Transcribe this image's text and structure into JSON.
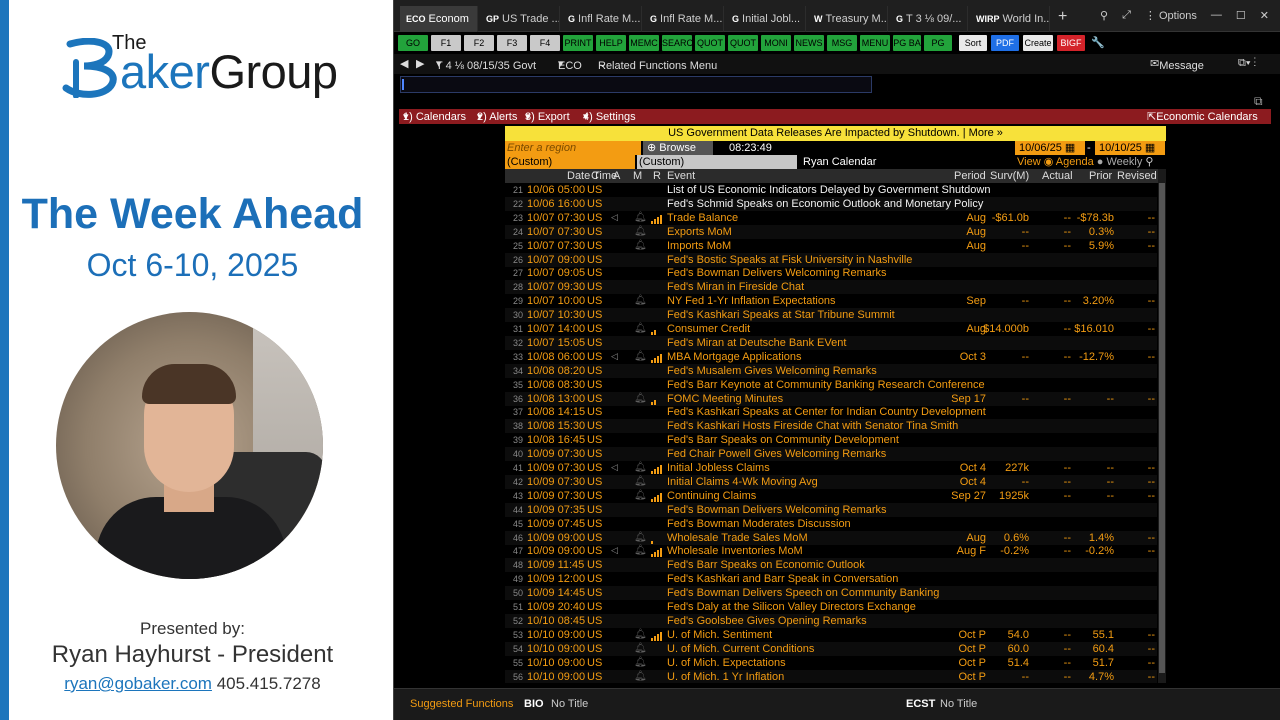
{
  "presentation": {
    "logo_the": "The",
    "logo_aker": "aker",
    "logo_group": "Group",
    "headline": "The Week Ahead",
    "dates": "Oct 6-10, 2025",
    "presented_by": "Presented by:",
    "presenter": "Ryan Hayhurst - President",
    "email": "ryan@gobaker.com",
    "phone": "405.415.7278",
    "accent_color": "#1c75bc"
  },
  "terminal": {
    "tabs": [
      {
        "code": "ECO",
        "label": "Econom"
      },
      {
        "code": "GP",
        "label": "US Trade ..."
      },
      {
        "code": "G",
        "label": "Infl Rate M..."
      },
      {
        "code": "G",
        "label": "Infl Rate M..."
      },
      {
        "code": "G",
        "label": "Initial Jobl..."
      },
      {
        "code": "W",
        "label": "Treasury M..."
      },
      {
        "code": "G",
        "label": "T 3 ⅛ 09/..."
      },
      {
        "code": "WIRP",
        "label": "World In..."
      }
    ],
    "window_controls": {
      "options": "Options"
    },
    "function_keys": [
      {
        "label": "GO",
        "style": "green"
      },
      {
        "label": "F1",
        "style": "grey"
      },
      {
        "label": "F2",
        "style": "grey"
      },
      {
        "label": "F3",
        "style": "grey"
      },
      {
        "label": "F4",
        "style": "grey"
      },
      {
        "label": "PRINT",
        "style": "green"
      },
      {
        "label": "HELP",
        "style": "green"
      },
      {
        "label": "MEMC",
        "style": "green"
      },
      {
        "label": "SEARC",
        "style": "green"
      },
      {
        "label": "QUOT",
        "style": "green"
      },
      {
        "label": "QUOT",
        "style": "green"
      },
      {
        "label": "MONI",
        "style": "green"
      },
      {
        "label": "NEWS",
        "style": "green"
      },
      {
        "label": "MSG",
        "style": "green"
      },
      {
        "label": "MENU",
        "style": "green"
      },
      {
        "label": "PG BA",
        "style": "green"
      },
      {
        "label": "PG FW",
        "style": "green"
      },
      {
        "label": "Sort",
        "style": "white"
      },
      {
        "label": "PDF",
        "style": "blue"
      },
      {
        "label": "Create",
        "style": "white"
      },
      {
        "label": "BIGF",
        "style": "red"
      }
    ],
    "nav": {
      "security": "T 4 ⅛ 08/15/35 Govt",
      "function": "ECO",
      "related": "Related Functions Menu",
      "message": "Message"
    },
    "menu": {
      "calendars": "1) Calendars",
      "alerts": "2) Alerts",
      "export": "3) Export",
      "settings": "4) Settings",
      "economic_calendars": "Economic Calendars"
    },
    "banner": "US Government Data Releases Are Impacted by Shutdown. | More »",
    "region_placeholder": "Enter a region",
    "browse": "Browse",
    "time": "08:23:49",
    "date_from": "10/06/25",
    "date_to": "10/10/25",
    "custom1": "(Custom)",
    "custom2": "(Custom)",
    "calendar_name": "Ryan Calendar",
    "view_label": "View",
    "view_agenda": "Agenda",
    "view_weekly": "Weekly",
    "columns": {
      "datetime": "Date Time",
      "c": "C",
      "a": "A",
      "m": "M",
      "r": "R",
      "event": "Event",
      "period": "Period",
      "surv": "Surv(M)",
      "actual": "Actual",
      "prior": "Prior",
      "revised": "Revised"
    },
    "rows": [
      {
        "n": "21",
        "dt": "10/06 05:00",
        "c": "US",
        "ev": "List of US Economic Indicators Delayed by Government Shutdown",
        "color": "white",
        "per": "",
        "surv": "",
        "act": "",
        "prior": "",
        "rev": "",
        "bell": false,
        "bars": 0,
        "spk": false
      },
      {
        "n": "22",
        "dt": "10/06 16:00",
        "c": "US",
        "ev": "Fed's Schmid Speaks on Economic Outlook and Monetary Policy",
        "color": "white",
        "per": "",
        "surv": "",
        "act": "",
        "prior": "",
        "rev": "",
        "bell": false,
        "bars": 0,
        "spk": false
      },
      {
        "n": "23",
        "dt": "10/07 07:30",
        "c": "US",
        "ev": "Trade Balance",
        "color": "orange",
        "per": "Aug",
        "surv": "-$61.0b",
        "act": "--",
        "prior": "-$78.3b",
        "rev": "--",
        "bell": true,
        "bars": 4,
        "spk": true
      },
      {
        "n": "24",
        "dt": "10/07 07:30",
        "c": "US",
        "ev": "Exports MoM",
        "color": "orange",
        "per": "Aug",
        "surv": "--",
        "act": "--",
        "prior": "0.3%",
        "rev": "--",
        "bell": true,
        "bars": 0,
        "spk": false
      },
      {
        "n": "25",
        "dt": "10/07 07:30",
        "c": "US",
        "ev": "Imports MoM",
        "color": "orange",
        "per": "Aug",
        "surv": "--",
        "act": "--",
        "prior": "5.9%",
        "rev": "--",
        "bell": true,
        "bars": 0,
        "spk": false
      },
      {
        "n": "26",
        "dt": "10/07 09:00",
        "c": "US",
        "ev": "Fed's Bostic Speaks at Fisk University in Nashville",
        "color": "orange",
        "per": "",
        "surv": "",
        "act": "",
        "prior": "",
        "rev": "",
        "bell": false,
        "bars": 0,
        "spk": false
      },
      {
        "n": "27",
        "dt": "10/07 09:05",
        "c": "US",
        "ev": "Fed's Bowman Delivers Welcoming Remarks",
        "color": "orange",
        "per": "",
        "surv": "",
        "act": "",
        "prior": "",
        "rev": "",
        "bell": false,
        "bars": 0,
        "spk": false
      },
      {
        "n": "28",
        "dt": "10/07 09:30",
        "c": "US",
        "ev": "Fed's Miran in Fireside Chat",
        "color": "orange",
        "per": "",
        "surv": "",
        "act": "",
        "prior": "",
        "rev": "",
        "bell": false,
        "bars": 0,
        "spk": false
      },
      {
        "n": "29",
        "dt": "10/07 10:00",
        "c": "US",
        "ev": "NY Fed 1-Yr Inflation Expectations",
        "color": "orange",
        "per": "Sep",
        "surv": "--",
        "act": "--",
        "prior": "3.20%",
        "rev": "--",
        "bell": true,
        "bars": 0,
        "spk": false
      },
      {
        "n": "30",
        "dt": "10/07 10:30",
        "c": "US",
        "ev": "Fed's Kashkari Speaks at Star Tribune Summit",
        "color": "orange",
        "per": "",
        "surv": "",
        "act": "",
        "prior": "",
        "rev": "",
        "bell": false,
        "bars": 0,
        "spk": false
      },
      {
        "n": "31",
        "dt": "10/07 14:00",
        "c": "US",
        "ev": "Consumer Credit",
        "color": "orange",
        "per": "Aug",
        "surv": "$14.000b",
        "act": "--",
        "prior": "$16.010",
        "rev": "--",
        "bell": true,
        "bars": 2,
        "spk": false
      },
      {
        "n": "32",
        "dt": "10/07 15:05",
        "c": "US",
        "ev": "Fed's Miran at Deutsche Bank EVent",
        "color": "orange",
        "per": "",
        "surv": "",
        "act": "",
        "prior": "",
        "rev": "",
        "bell": false,
        "bars": 0,
        "spk": false
      },
      {
        "n": "33",
        "dt": "10/08 06:00",
        "c": "US",
        "ev": "MBA Mortgage Applications",
        "color": "orange",
        "per": "Oct 3",
        "surv": "--",
        "act": "--",
        "prior": "-12.7%",
        "rev": "--",
        "bell": true,
        "bars": 4,
        "spk": true
      },
      {
        "n": "34",
        "dt": "10/08 08:20",
        "c": "US",
        "ev": "Fed's Musalem Gives Welcoming Remarks",
        "color": "orange",
        "per": "",
        "surv": "",
        "act": "",
        "prior": "",
        "rev": "",
        "bell": false,
        "bars": 0,
        "spk": false
      },
      {
        "n": "35",
        "dt": "10/08 08:30",
        "c": "US",
        "ev": "Fed's Barr Keynote at Community Banking Research Conference",
        "color": "orange",
        "per": "",
        "surv": "",
        "act": "",
        "prior": "",
        "rev": "",
        "bell": false,
        "bars": 0,
        "spk": false
      },
      {
        "n": "36",
        "dt": "10/08 13:00",
        "c": "US",
        "ev": "FOMC Meeting Minutes",
        "color": "orange",
        "per": "Sep 17",
        "surv": "--",
        "act": "--",
        "prior": "--",
        "rev": "--",
        "bell": true,
        "bars": 2,
        "spk": false
      },
      {
        "n": "37",
        "dt": "10/08 14:15",
        "c": "US",
        "ev": "Fed's Kashkari Speaks at Center for Indian Country Development",
        "color": "orange",
        "per": "",
        "surv": "",
        "act": "",
        "prior": "",
        "rev": "",
        "bell": false,
        "bars": 0,
        "spk": false
      },
      {
        "n": "38",
        "dt": "10/08 15:30",
        "c": "US",
        "ev": "Fed's Kashkari Hosts Fireside Chat with Senator Tina Smith",
        "color": "orange",
        "per": "",
        "surv": "",
        "act": "",
        "prior": "",
        "rev": "",
        "bell": false,
        "bars": 0,
        "spk": false
      },
      {
        "n": "39",
        "dt": "10/08 16:45",
        "c": "US",
        "ev": "Fed's Barr Speaks on Community Development",
        "color": "orange",
        "per": "",
        "surv": "",
        "act": "",
        "prior": "",
        "rev": "",
        "bell": false,
        "bars": 0,
        "spk": false
      },
      {
        "n": "40",
        "dt": "10/09 07:30",
        "c": "US",
        "ev": "Fed Chair Powell Gives Welcoming Remarks",
        "color": "orange",
        "per": "",
        "surv": "",
        "act": "",
        "prior": "",
        "rev": "",
        "bell": false,
        "bars": 0,
        "spk": false
      },
      {
        "n": "41",
        "dt": "10/09 07:30",
        "c": "US",
        "ev": "Initial Jobless Claims",
        "color": "orange",
        "per": "Oct 4",
        "surv": "227k",
        "act": "--",
        "prior": "--",
        "rev": "--",
        "bell": true,
        "bars": 4,
        "spk": true
      },
      {
        "n": "42",
        "dt": "10/09 07:30",
        "c": "US",
        "ev": "Initial Claims 4-Wk Moving Avg",
        "color": "orange",
        "per": "Oct 4",
        "surv": "--",
        "act": "--",
        "prior": "--",
        "rev": "--",
        "bell": true,
        "bars": 0,
        "spk": false
      },
      {
        "n": "43",
        "dt": "10/09 07:30",
        "c": "US",
        "ev": "Continuing Claims",
        "color": "orange",
        "per": "Sep 27",
        "surv": "1925k",
        "act": "--",
        "prior": "--",
        "rev": "--",
        "bell": true,
        "bars": 4,
        "spk": false
      },
      {
        "n": "44",
        "dt": "10/09 07:35",
        "c": "US",
        "ev": "Fed's Bowman Delivers Welcoming Remarks",
        "color": "orange",
        "per": "",
        "surv": "",
        "act": "",
        "prior": "",
        "rev": "",
        "bell": false,
        "bars": 0,
        "spk": false
      },
      {
        "n": "45",
        "dt": "10/09 07:45",
        "c": "US",
        "ev": "Fed's Bowman Moderates Discussion",
        "color": "orange",
        "per": "",
        "surv": "",
        "act": "",
        "prior": "",
        "rev": "",
        "bell": false,
        "bars": 0,
        "spk": false
      },
      {
        "n": "46",
        "dt": "10/09 09:00",
        "c": "US",
        "ev": "Wholesale Trade Sales MoM",
        "color": "orange",
        "per": "Aug",
        "surv": "0.6%",
        "act": "--",
        "prior": "1.4%",
        "rev": "--",
        "bell": true,
        "bars": 1,
        "spk": false
      },
      {
        "n": "47",
        "dt": "10/09 09:00",
        "c": "US",
        "ev": "Wholesale Inventories MoM",
        "color": "orange",
        "per": "Aug F",
        "surv": "-0.2%",
        "act": "--",
        "prior": "-0.2%",
        "rev": "--",
        "bell": true,
        "bars": 4,
        "spk": true
      },
      {
        "n": "48",
        "dt": "10/09 11:45",
        "c": "US",
        "ev": "Fed's Barr Speaks on Economic Outlook",
        "color": "orange",
        "per": "",
        "surv": "",
        "act": "",
        "prior": "",
        "rev": "",
        "bell": false,
        "bars": 0,
        "spk": false
      },
      {
        "n": "49",
        "dt": "10/09 12:00",
        "c": "US",
        "ev": "Fed's Kashkari and Barr Speak in Conversation",
        "color": "orange",
        "per": "",
        "surv": "",
        "act": "",
        "prior": "",
        "rev": "",
        "bell": false,
        "bars": 0,
        "spk": false
      },
      {
        "n": "50",
        "dt": "10/09 14:45",
        "c": "US",
        "ev": "Fed's Bowman Delivers Speech on Community Banking",
        "color": "orange",
        "per": "",
        "surv": "",
        "act": "",
        "prior": "",
        "rev": "",
        "bell": false,
        "bars": 0,
        "spk": false
      },
      {
        "n": "51",
        "dt": "10/09 20:40",
        "c": "US",
        "ev": "Fed's Daly at the Silicon Valley Directors Exchange",
        "color": "orange",
        "per": "",
        "surv": "",
        "act": "",
        "prior": "",
        "rev": "",
        "bell": false,
        "bars": 0,
        "spk": false
      },
      {
        "n": "52",
        "dt": "10/10 08:45",
        "c": "US",
        "ev": "Fed's Goolsbee Gives Opening Remarks",
        "color": "orange",
        "per": "",
        "surv": "",
        "act": "",
        "prior": "",
        "rev": "",
        "bell": false,
        "bars": 0,
        "spk": false
      },
      {
        "n": "53",
        "dt": "10/10 09:00",
        "c": "US",
        "ev": "U. of Mich. Sentiment",
        "color": "orange",
        "per": "Oct P",
        "surv": "54.0",
        "act": "--",
        "prior": "55.1",
        "rev": "--",
        "bell": true,
        "bars": 4,
        "spk": false
      },
      {
        "n": "54",
        "dt": "10/10 09:00",
        "c": "US",
        "ev": "U. of Mich. Current Conditions",
        "color": "orange",
        "per": "Oct P",
        "surv": "60.0",
        "act": "--",
        "prior": "60.4",
        "rev": "--",
        "bell": true,
        "bars": 0,
        "spk": false
      },
      {
        "n": "55",
        "dt": "10/10 09:00",
        "c": "US",
        "ev": "U. of Mich. Expectations",
        "color": "orange",
        "per": "Oct P",
        "surv": "51.4",
        "act": "--",
        "prior": "51.7",
        "rev": "--",
        "bell": true,
        "bars": 0,
        "spk": false
      },
      {
        "n": "56",
        "dt": "10/10 09:00",
        "c": "US",
        "ev": "U. of Mich. 1 Yr Inflation",
        "color": "orange",
        "per": "Oct P",
        "surv": "--",
        "act": "--",
        "prior": "4.7%",
        "rev": "--",
        "bell": true,
        "bars": 0,
        "spk": false
      }
    ],
    "bottom": {
      "suggested": "Suggested Functions",
      "bio_code": "BIO",
      "bio_title": "No Title",
      "ecst_code": "ECST",
      "ecst_title": "No Title"
    }
  }
}
